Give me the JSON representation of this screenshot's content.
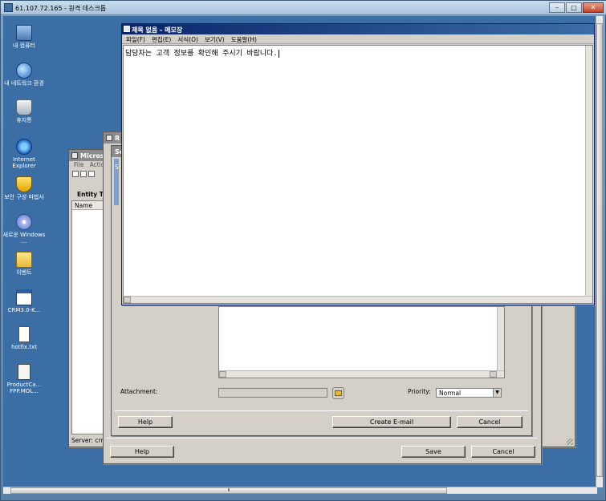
{
  "rdp": {
    "title": "61.107.72.165 - 원격 데스크톱",
    "min": "–",
    "max": "□",
    "close": "✕"
  },
  "desktop_icons": [
    {
      "label": "내 컴퓨터",
      "icon": "computer-icon"
    },
    {
      "label": "내 네트워크 환경",
      "icon": "network-icon"
    },
    {
      "label": "휴지통",
      "icon": "recycle-bin-icon"
    },
    {
      "label": "Internet Explorer",
      "icon": "internet-explorer-icon"
    },
    {
      "label": "보안 구성 마법사",
      "icon": "security-wizard-icon"
    },
    {
      "label": "새로운 Windows ...",
      "icon": "cd-icon"
    },
    {
      "label": "이벤트",
      "icon": "folder-icon"
    },
    {
      "label": "CRM3.0-K...",
      "icon": "window-shortcut-icon"
    },
    {
      "label": "hotfix.txt",
      "icon": "text-file-icon"
    },
    {
      "label": "ProductCa... FPP.MOL...",
      "icon": "file-icon"
    }
  ],
  "crm_window": {
    "title": "Micros",
    "menu": [
      "File",
      "Actio"
    ],
    "entity_label": "Entity Ty",
    "list_header": "Name",
    "status": "Server: crm"
  },
  "mid_window": {
    "title": "R",
    "help": "Help",
    "save": "Save",
    "cancel": "Cancel"
  },
  "dialog": {
    "title": "Se",
    "tab": "S",
    "attachment_label": "Attachment:",
    "priority_label": "Priority:",
    "priority_value": "Normal",
    "help": "Help",
    "create_email": "Create E-mail",
    "cancel": "Cancel"
  },
  "notepad": {
    "title": "제목 없음 - 메모장",
    "menu": [
      "파일(F)",
      "편집(E)",
      "서식(O)",
      "보기(V)",
      "도움말(H)"
    ],
    "content": "담당자는 고객 정보를 확인해 주시기 바랍니다."
  },
  "scrollbar": {
    "thumb_grip": "⦀"
  }
}
